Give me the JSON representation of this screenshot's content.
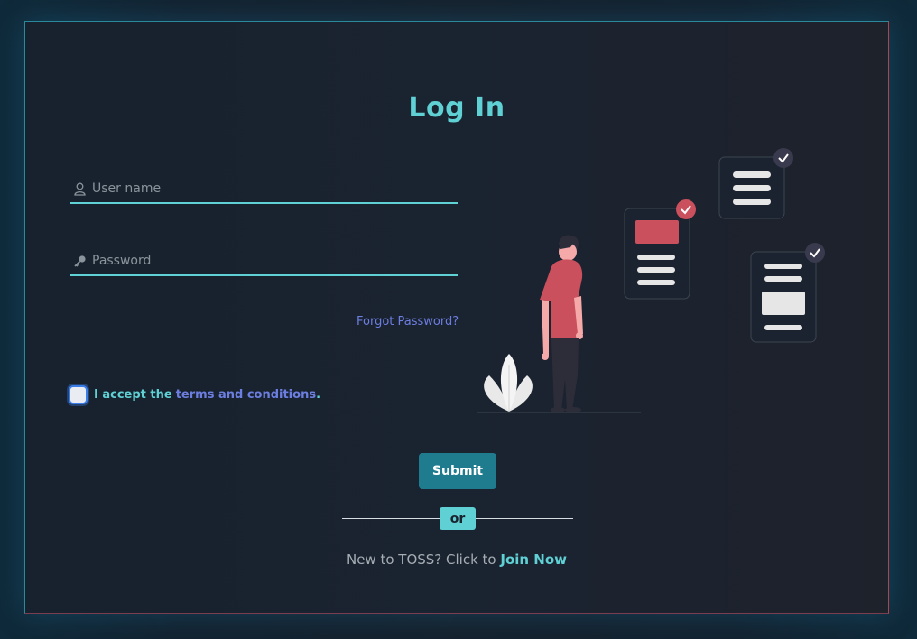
{
  "form": {
    "title": "Log In",
    "username": {
      "placeholder": "User name",
      "value": "",
      "icon": "user-icon"
    },
    "password": {
      "placeholder": "Password",
      "value": "",
      "icon": "key-icon"
    },
    "forgot_label": "Forgot Password?",
    "terms": {
      "prefix": "I accept the",
      "link": "terms and conditions",
      "suffix": ".",
      "checked": false
    },
    "submit_label": "Submit",
    "or_label": "or",
    "join": {
      "prefix": "New to TOSS? Click to",
      "link": "Join Now"
    }
  },
  "colors": {
    "accent": "#5fd0d3",
    "link": "#6c7ee0",
    "submit": "#1f7b8e",
    "illustration_red": "#c9505c",
    "background": "#1b2330"
  }
}
